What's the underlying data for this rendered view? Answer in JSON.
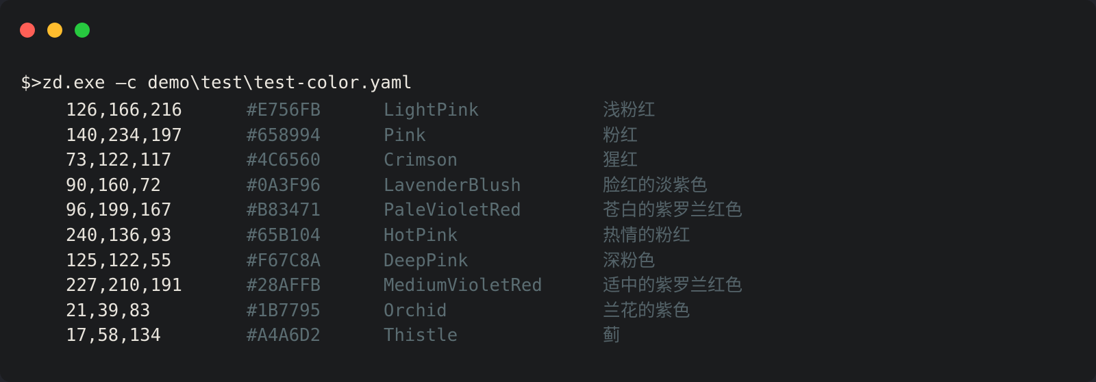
{
  "window": {
    "background": "#1b1c1e",
    "backdrop": "#22242b",
    "controls": [
      {
        "name": "close",
        "color": "#ff5f56"
      },
      {
        "name": "minimize",
        "color": "#ffbd2e"
      },
      {
        "name": "maximize",
        "color": "#27c93f"
      }
    ]
  },
  "terminal": {
    "prompt": "$>zd.exe –c demo\\test\\test-color.yaml",
    "text_color": "#ece8e0",
    "rgb_color": "#e8e4dc",
    "hex_color": "#5b6d72",
    "name_color": "#5b6d72",
    "cn_color": "#55646a",
    "rows": [
      {
        "rgb": "126,166,216",
        "hex": "#E756FB",
        "name": "LightPink",
        "cn": "浅粉红"
      },
      {
        "rgb": "140,234,197",
        "hex": "#658994",
        "name": "Pink",
        "cn": "粉红"
      },
      {
        "rgb": "73,122,117",
        "hex": "#4C6560",
        "name": "Crimson",
        "cn": "猩红"
      },
      {
        "rgb": "90,160,72",
        "hex": "#0A3F96",
        "name": "LavenderBlush",
        "cn": "脸红的淡紫色"
      },
      {
        "rgb": "96,199,167",
        "hex": "#B83471",
        "name": "PaleVioletRed",
        "cn": "苍白的紫罗兰红色"
      },
      {
        "rgb": "240,136,93",
        "hex": "#65B104",
        "name": "HotPink",
        "cn": "热情的粉红"
      },
      {
        "rgb": "125,122,55",
        "hex": "#F67C8A",
        "name": "DeepPink",
        "cn": "深粉色"
      },
      {
        "rgb": "227,210,191",
        "hex": "#28AFFB",
        "name": "MediumVioletRed",
        "cn": "适中的紫罗兰红色"
      },
      {
        "rgb": "21,39,83",
        "hex": "#1B7795",
        "name": "Orchid",
        "cn": "兰花的紫色"
      },
      {
        "rgb": "17,58,134",
        "hex": "#A4A6D2",
        "name": "Thistle",
        "cn": "蓟"
      }
    ]
  }
}
